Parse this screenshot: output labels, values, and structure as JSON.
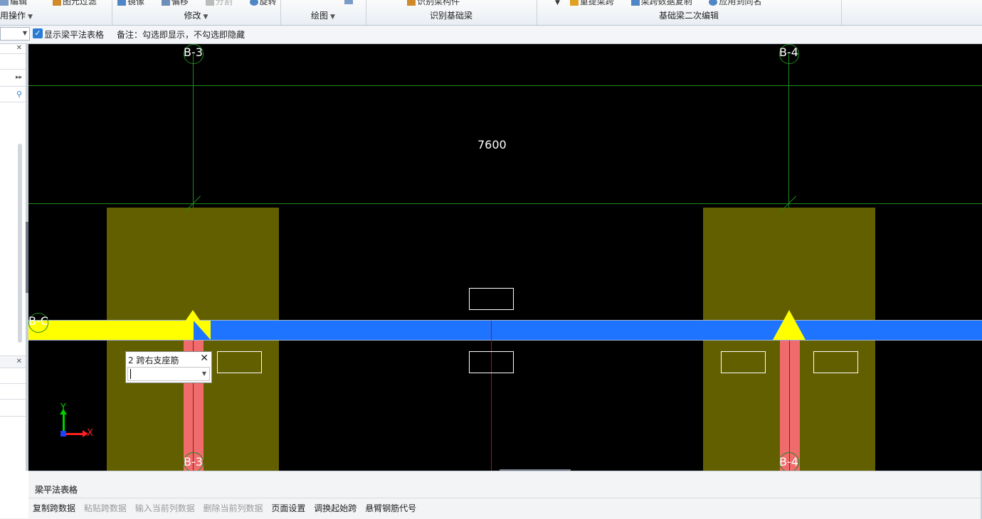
{
  "ribbon": {
    "groups": [
      {
        "top_items": [
          "编辑",
          "图元过滤"
        ],
        "label": "用操作",
        "has_caret": true
      },
      {
        "top_items": [
          "镜像",
          "偏移",
          "分割",
          "旋转"
        ],
        "label": "修改",
        "has_caret": true
      },
      {
        "top_items": [
          ""
        ],
        "label": "绘图",
        "has_caret": true
      },
      {
        "top_items": [
          "识别梁构件"
        ],
        "label": "识别基础梁",
        "has_caret": false
      },
      {
        "top_items": [
          "重提梁跨",
          "梁跨数据复制",
          "应用到同名"
        ],
        "label": "基础梁二次编辑",
        "has_caret": false
      }
    ]
  },
  "options": {
    "show_table_checked": true,
    "show_table_label": "显示梁平法表格",
    "note": "备注：勾选即显示，不勾选即隐藏"
  },
  "canvas": {
    "grid_top_labels": [
      "B-3",
      "B-4"
    ],
    "grid_bottom_labels": [
      "B-3",
      "B-4"
    ],
    "left_axis_label": "B-C",
    "dimension": "7600",
    "axis_y": "Y",
    "axis_x": "X"
  },
  "popup": {
    "title": "2 跨右支座筋",
    "close": "✕",
    "input_value": ""
  },
  "bottom_panel": {
    "title": "梁平法表格",
    "toolbar": [
      {
        "label": "复制跨数据",
        "enabled": true
      },
      {
        "label": "粘贴跨数据",
        "enabled": false
      },
      {
        "label": "输入当前列数据",
        "enabled": false
      },
      {
        "label": "删除当前列数据",
        "enabled": false
      },
      {
        "label": "页面设置",
        "enabled": true
      },
      {
        "label": "调换起始跨",
        "enabled": true
      },
      {
        "label": "悬臂钢筋代号",
        "enabled": true
      }
    ]
  },
  "colors": {
    "canvas_bg": "#000000",
    "grid_line": "#1f8a1f",
    "column": "#625f00",
    "pile": "#f06c6c",
    "beam_blue": "#1e73ff",
    "beam_yellow": "#ffff00"
  }
}
